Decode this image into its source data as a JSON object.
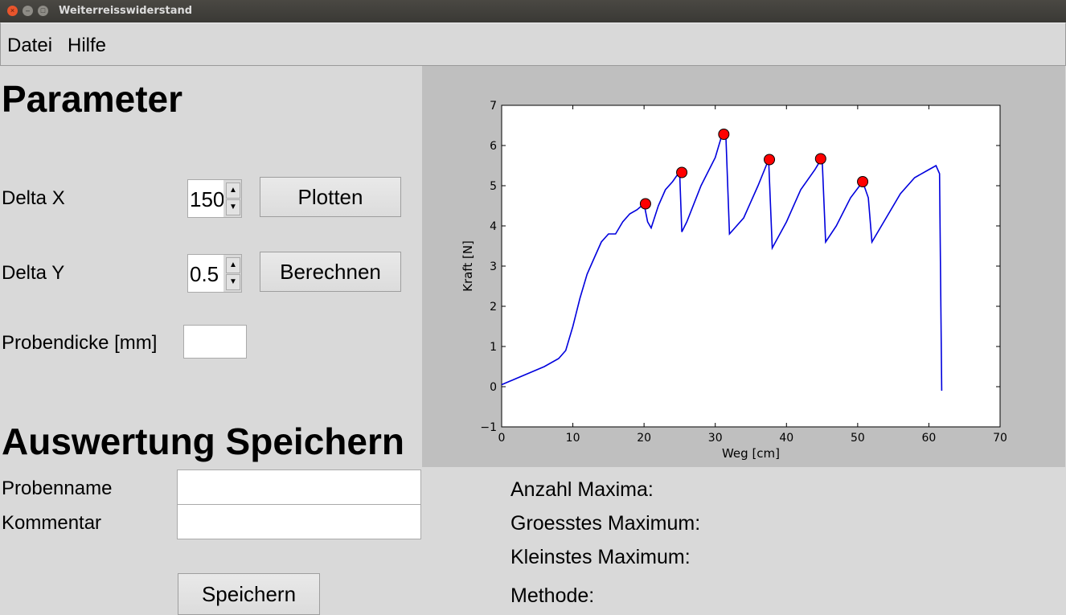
{
  "window": {
    "title": "Weiterreisswiderstand"
  },
  "menu": {
    "items": [
      "Datei",
      "Hilfe"
    ]
  },
  "parameter": {
    "heading": "Parameter",
    "delta_x_label": "Delta X",
    "delta_x_value": "150",
    "delta_y_label": "Delta Y",
    "delta_y_value": "0.5",
    "probendicke_label": "Probendicke [mm]",
    "probendicke_value": "",
    "plot_button": "Plotten",
    "calc_button": "Berechnen"
  },
  "save": {
    "heading": "Auswertung Speichern",
    "probenname_label": "Probenname",
    "probenname_value": "",
    "kommentar_label": "Kommentar",
    "kommentar_value": "",
    "save_button": "Speichern"
  },
  "stats": {
    "anzahl": "Anzahl Maxima:",
    "groesstes": "Groesstes Maximum:",
    "kleinstes": "Kleinstes Maximum:",
    "methode": "Methode:"
  },
  "chart_data": {
    "type": "line",
    "title": "",
    "xlabel": "Weg [cm]",
    "ylabel": "Kraft [N]",
    "xlim": [
      0,
      70
    ],
    "ylim": [
      -1,
      7
    ],
    "xticks": [
      0,
      10,
      20,
      30,
      40,
      50,
      60,
      70
    ],
    "yticks": [
      -1,
      0,
      1,
      2,
      3,
      4,
      5,
      6,
      7
    ],
    "line_color": "#0000dd",
    "marker_color": "#ff0000",
    "series": [
      {
        "x": [
          0,
          2,
          4,
          6,
          8,
          9,
          10,
          11,
          12,
          13,
          14,
          15,
          16,
          17,
          18,
          19,
          20,
          20.5,
          21,
          22,
          23,
          24,
          25,
          25.3,
          26,
          28,
          30,
          31,
          31.5,
          32,
          34,
          36,
          37.5,
          38,
          40,
          42,
          44,
          45,
          45.5,
          47,
          49,
          50.7,
          51.5,
          52,
          54,
          56,
          58,
          60,
          61,
          61.5,
          61.8
        ],
        "y": [
          0.05,
          0.2,
          0.35,
          0.5,
          0.7,
          0.9,
          1.5,
          2.2,
          2.8,
          3.2,
          3.6,
          3.8,
          3.8,
          4.1,
          4.3,
          4.4,
          4.55,
          4.1,
          3.95,
          4.5,
          4.9,
          5.1,
          5.35,
          3.85,
          4.1,
          5.0,
          5.7,
          6.3,
          6.2,
          3.8,
          4.2,
          5.0,
          5.65,
          3.45,
          4.1,
          4.9,
          5.4,
          5.7,
          3.6,
          4.0,
          4.7,
          5.1,
          4.7,
          3.6,
          4.2,
          4.8,
          5.2,
          5.4,
          5.5,
          5.3,
          -0.1
        ]
      }
    ],
    "maxima": {
      "x": [
        20.2,
        25.3,
        31.2,
        37.6,
        44.8,
        50.7
      ],
      "y": [
        4.55,
        5.33,
        6.28,
        5.65,
        5.67,
        5.1
      ]
    }
  }
}
